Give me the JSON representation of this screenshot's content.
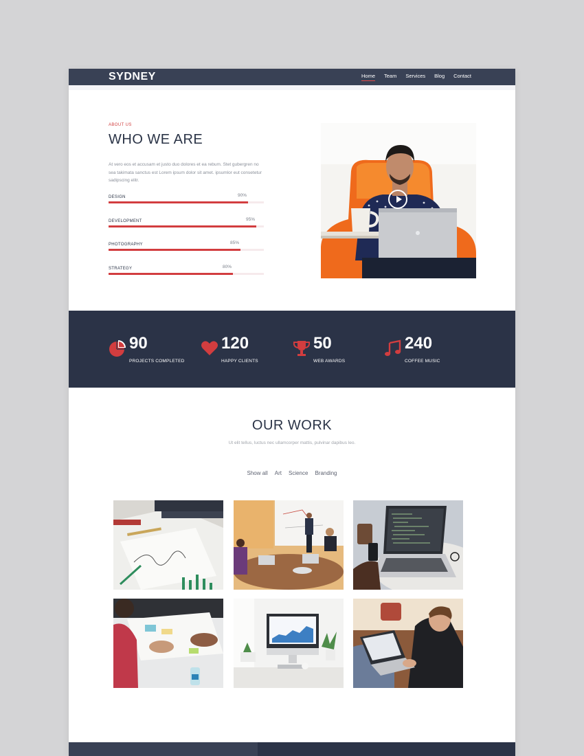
{
  "header": {
    "logo": "SYDNEY",
    "nav": [
      "Home",
      "Team",
      "Services",
      "Blog",
      "Contact"
    ],
    "active_nav": "Home"
  },
  "about": {
    "eyebrow": "ABOUT US",
    "title": "WHO WE ARE",
    "text": "At vero eos et accusam et justo duo dolores et ea rebum. Stet gubergren no sea takimata sanctus est Lorem ipsum dolor sit amet. ipsumlor eut consetetur sadipscing elitr.",
    "skills": [
      {
        "label": "DESIGN",
        "percent": "90%",
        "value": 90
      },
      {
        "label": "DEVELOPMENT",
        "percent": "95%",
        "value": 95
      },
      {
        "label": "PHOTOGRAPHY",
        "percent": "85%",
        "value": 85
      },
      {
        "label": "STRATEGY",
        "percent": "80%",
        "value": 80
      }
    ],
    "photo_icon": "play-icon"
  },
  "stats": [
    {
      "icon": "pie-chart-icon",
      "number": "90",
      "label": "PROJECTS COMPLETED"
    },
    {
      "icon": "heart-icon",
      "number": "120",
      "label": "HAPPY CLIENTS"
    },
    {
      "icon": "trophy-icon",
      "number": "50",
      "label": "WEB AWARDS"
    },
    {
      "icon": "music-note-icon",
      "number": "240",
      "label": "COFFEE MUSIC"
    }
  ],
  "work": {
    "title": "OUR WORK",
    "subtitle": "Ut elit tellus, luctus nec ullamcorper mattis, pulvinar dapibus leo.",
    "filters": [
      "Show all",
      "Art",
      "Science",
      "Branding"
    ]
  },
  "colors": {
    "header": "#394155",
    "stats_band": "#2b3347",
    "accent": "#d23d3f",
    "heading": "#2a3346"
  }
}
